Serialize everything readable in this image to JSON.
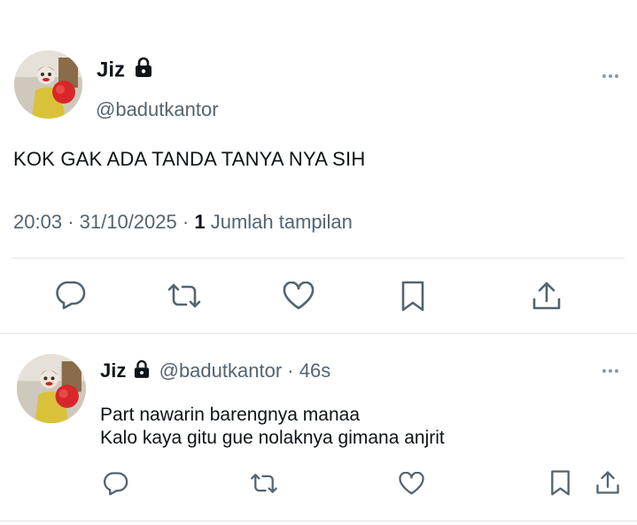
{
  "main_tweet": {
    "display_name": "Jiz",
    "handle": "@badutkantor",
    "text": "KOK GAK ADA TANDA TANYA NYA SIH",
    "time": "20:03",
    "date": "31/10/2025",
    "views_count": "1",
    "views_label": "Jumlah tampilan",
    "separator": "·"
  },
  "reply": {
    "display_name": "Jiz",
    "handle": "@badutkantor",
    "separator": "·",
    "time_ago": "46s",
    "line1": "Part nawarin barengnya manaa",
    "line2": "Kalo kaya gitu gue nolaknya gimana anjrit"
  },
  "icons": [
    "more-icon",
    "reply-icon",
    "retweet-icon",
    "like-icon",
    "bookmark-icon",
    "share-icon",
    "lock-icon"
  ],
  "colors": {
    "text": "#0f1419",
    "muted": "#536471",
    "divider": "#e1e5e8",
    "icon": "#536471"
  }
}
